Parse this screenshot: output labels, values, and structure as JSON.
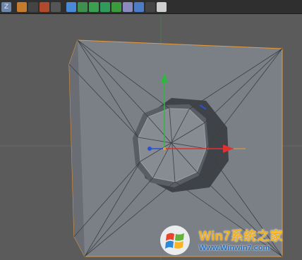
{
  "toolbar": {
    "tools": [
      {
        "name": "z-button",
        "label": "Z",
        "color": "#6e86a8"
      },
      {
        "name": "render-region-icon",
        "label": "",
        "color": "#c57a2c"
      },
      {
        "name": "render-view-icon",
        "label": "",
        "color": "#444444"
      },
      {
        "name": "render-picture-viewer-icon",
        "label": "",
        "color": "#b04a2c"
      },
      {
        "name": "edit-render-settings-icon",
        "label": "",
        "color": "#555555"
      },
      {
        "name": "cube-icon",
        "label": "",
        "color": "#4a88d8"
      },
      {
        "name": "pen-icon",
        "label": "",
        "color": "#3f8f4f"
      },
      {
        "name": "subdivision-icon",
        "label": "",
        "color": "#3aa050"
      },
      {
        "name": "array-icon",
        "label": "",
        "color": "#2f9a5a"
      },
      {
        "name": "deformer-icon",
        "label": "",
        "color": "#3c9a3c"
      },
      {
        "name": "environment-icon",
        "label": "",
        "color": "#8a8ac0"
      },
      {
        "name": "floor-icon",
        "label": "",
        "color": "#4a7cc8"
      },
      {
        "name": "camera-icon",
        "label": "",
        "color": "#444444"
      },
      {
        "name": "light-icon",
        "label": "",
        "color": "#cfcfcf"
      }
    ]
  },
  "viewport": {
    "axis_colors": {
      "x": "#e03030",
      "y": "#2fb83f",
      "z": "#2a4fd8"
    },
    "selection_color": "#e89a3a",
    "mesh_color": "#7a7f86"
  },
  "watermark": {
    "brand": "Win7系统之家",
    "url": "Www.Winwin7.com"
  }
}
